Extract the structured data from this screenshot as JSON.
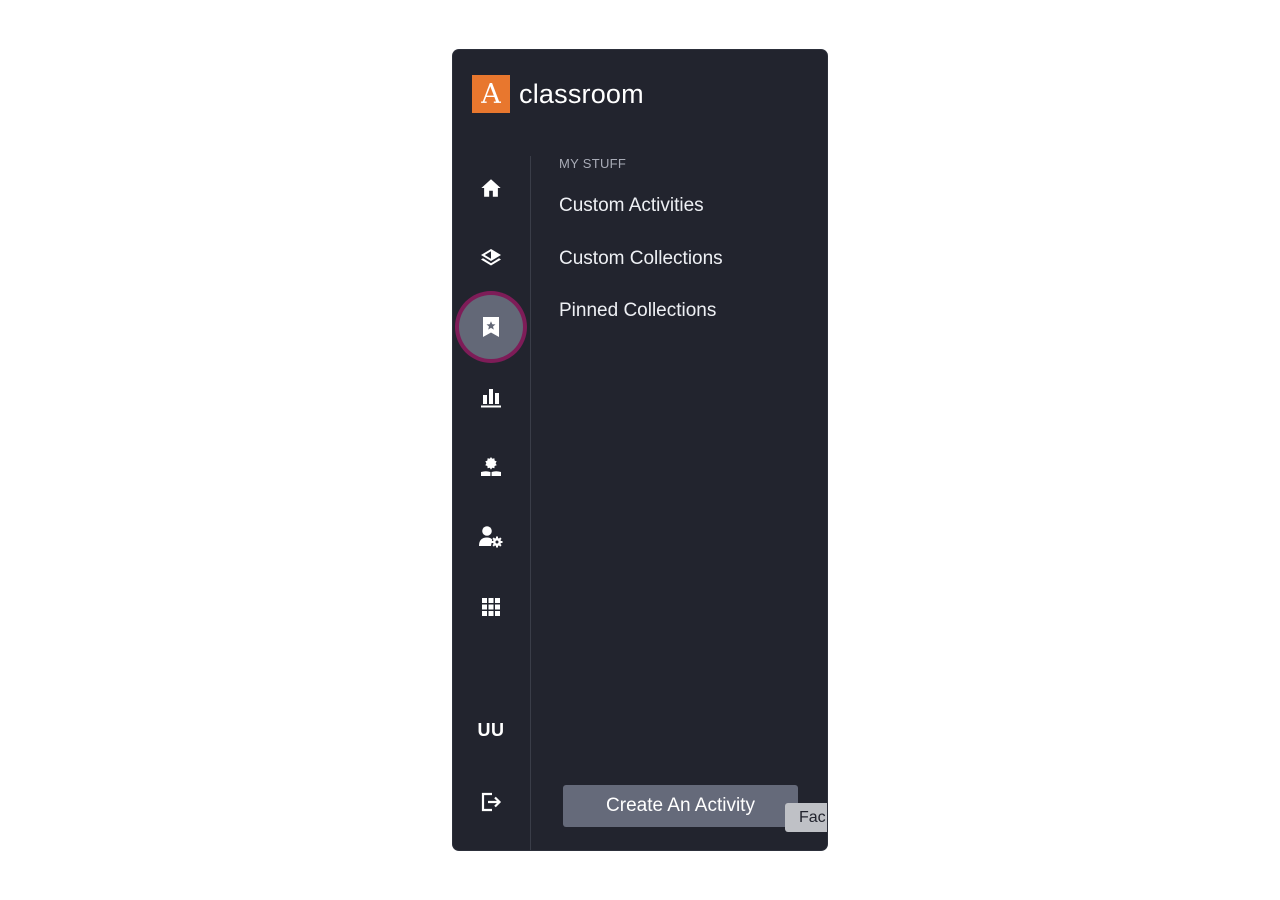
{
  "brand": {
    "logo_letter": "A",
    "name": "classroom",
    "accent": "#e8772e"
  },
  "rail": {
    "items": [
      {
        "icon": "home-icon",
        "active": false
      },
      {
        "icon": "layers-icon",
        "active": false
      },
      {
        "icon": "bookmark-star-icon",
        "active": true
      },
      {
        "icon": "bar-chart-icon",
        "active": false
      },
      {
        "icon": "teacher-icon",
        "active": false
      },
      {
        "icon": "user-settings-icon",
        "active": false
      },
      {
        "icon": "apps-grid-icon",
        "active": false
      }
    ],
    "avatar_initials": "UU",
    "logout_icon": "logout-icon",
    "active_ring_color": "#7e1c58"
  },
  "menu": {
    "section_label": "MY STUFF",
    "items": [
      "Custom Activities",
      "Custom Collections",
      "Pinned Collections"
    ]
  },
  "cta": {
    "label": "Create An Activity"
  },
  "tooltip": {
    "text": "Fac"
  },
  "colors": {
    "panel_bg": "#22242e",
    "cta_bg": "#656a7a"
  }
}
